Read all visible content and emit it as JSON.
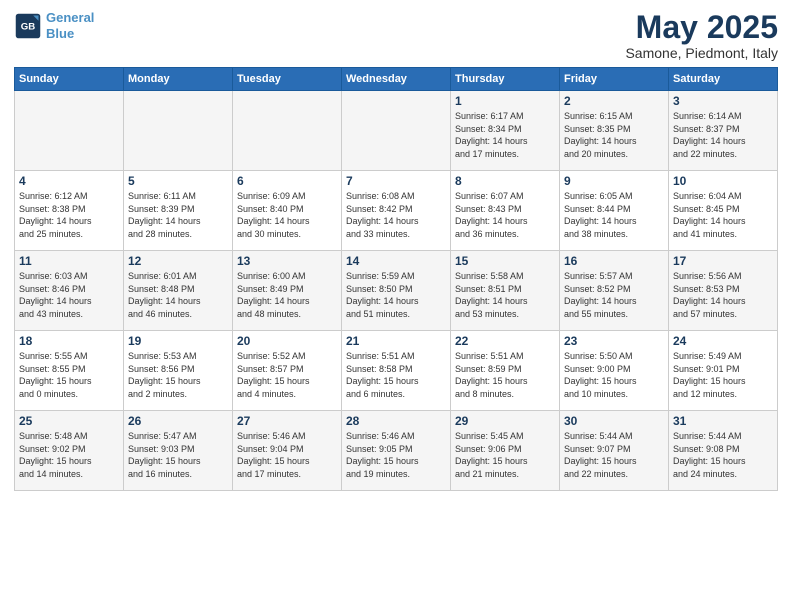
{
  "logo": {
    "line1": "General",
    "line2": "Blue"
  },
  "title": "May 2025",
  "subtitle": "Samone, Piedmont, Italy",
  "days_header": [
    "Sunday",
    "Monday",
    "Tuesday",
    "Wednesday",
    "Thursday",
    "Friday",
    "Saturday"
  ],
  "weeks": [
    [
      {
        "num": "",
        "info": ""
      },
      {
        "num": "",
        "info": ""
      },
      {
        "num": "",
        "info": ""
      },
      {
        "num": "",
        "info": ""
      },
      {
        "num": "1",
        "info": "Sunrise: 6:17 AM\nSunset: 8:34 PM\nDaylight: 14 hours\nand 17 minutes."
      },
      {
        "num": "2",
        "info": "Sunrise: 6:15 AM\nSunset: 8:35 PM\nDaylight: 14 hours\nand 20 minutes."
      },
      {
        "num": "3",
        "info": "Sunrise: 6:14 AM\nSunset: 8:37 PM\nDaylight: 14 hours\nand 22 minutes."
      }
    ],
    [
      {
        "num": "4",
        "info": "Sunrise: 6:12 AM\nSunset: 8:38 PM\nDaylight: 14 hours\nand 25 minutes."
      },
      {
        "num": "5",
        "info": "Sunrise: 6:11 AM\nSunset: 8:39 PM\nDaylight: 14 hours\nand 28 minutes."
      },
      {
        "num": "6",
        "info": "Sunrise: 6:09 AM\nSunset: 8:40 PM\nDaylight: 14 hours\nand 30 minutes."
      },
      {
        "num": "7",
        "info": "Sunrise: 6:08 AM\nSunset: 8:42 PM\nDaylight: 14 hours\nand 33 minutes."
      },
      {
        "num": "8",
        "info": "Sunrise: 6:07 AM\nSunset: 8:43 PM\nDaylight: 14 hours\nand 36 minutes."
      },
      {
        "num": "9",
        "info": "Sunrise: 6:05 AM\nSunset: 8:44 PM\nDaylight: 14 hours\nand 38 minutes."
      },
      {
        "num": "10",
        "info": "Sunrise: 6:04 AM\nSunset: 8:45 PM\nDaylight: 14 hours\nand 41 minutes."
      }
    ],
    [
      {
        "num": "11",
        "info": "Sunrise: 6:03 AM\nSunset: 8:46 PM\nDaylight: 14 hours\nand 43 minutes."
      },
      {
        "num": "12",
        "info": "Sunrise: 6:01 AM\nSunset: 8:48 PM\nDaylight: 14 hours\nand 46 minutes."
      },
      {
        "num": "13",
        "info": "Sunrise: 6:00 AM\nSunset: 8:49 PM\nDaylight: 14 hours\nand 48 minutes."
      },
      {
        "num": "14",
        "info": "Sunrise: 5:59 AM\nSunset: 8:50 PM\nDaylight: 14 hours\nand 51 minutes."
      },
      {
        "num": "15",
        "info": "Sunrise: 5:58 AM\nSunset: 8:51 PM\nDaylight: 14 hours\nand 53 minutes."
      },
      {
        "num": "16",
        "info": "Sunrise: 5:57 AM\nSunset: 8:52 PM\nDaylight: 14 hours\nand 55 minutes."
      },
      {
        "num": "17",
        "info": "Sunrise: 5:56 AM\nSunset: 8:53 PM\nDaylight: 14 hours\nand 57 minutes."
      }
    ],
    [
      {
        "num": "18",
        "info": "Sunrise: 5:55 AM\nSunset: 8:55 PM\nDaylight: 15 hours\nand 0 minutes."
      },
      {
        "num": "19",
        "info": "Sunrise: 5:53 AM\nSunset: 8:56 PM\nDaylight: 15 hours\nand 2 minutes."
      },
      {
        "num": "20",
        "info": "Sunrise: 5:52 AM\nSunset: 8:57 PM\nDaylight: 15 hours\nand 4 minutes."
      },
      {
        "num": "21",
        "info": "Sunrise: 5:51 AM\nSunset: 8:58 PM\nDaylight: 15 hours\nand 6 minutes."
      },
      {
        "num": "22",
        "info": "Sunrise: 5:51 AM\nSunset: 8:59 PM\nDaylight: 15 hours\nand 8 minutes."
      },
      {
        "num": "23",
        "info": "Sunrise: 5:50 AM\nSunset: 9:00 PM\nDaylight: 15 hours\nand 10 minutes."
      },
      {
        "num": "24",
        "info": "Sunrise: 5:49 AM\nSunset: 9:01 PM\nDaylight: 15 hours\nand 12 minutes."
      }
    ],
    [
      {
        "num": "25",
        "info": "Sunrise: 5:48 AM\nSunset: 9:02 PM\nDaylight: 15 hours\nand 14 minutes."
      },
      {
        "num": "26",
        "info": "Sunrise: 5:47 AM\nSunset: 9:03 PM\nDaylight: 15 hours\nand 16 minutes."
      },
      {
        "num": "27",
        "info": "Sunrise: 5:46 AM\nSunset: 9:04 PM\nDaylight: 15 hours\nand 17 minutes."
      },
      {
        "num": "28",
        "info": "Sunrise: 5:46 AM\nSunset: 9:05 PM\nDaylight: 15 hours\nand 19 minutes."
      },
      {
        "num": "29",
        "info": "Sunrise: 5:45 AM\nSunset: 9:06 PM\nDaylight: 15 hours\nand 21 minutes."
      },
      {
        "num": "30",
        "info": "Sunrise: 5:44 AM\nSunset: 9:07 PM\nDaylight: 15 hours\nand 22 minutes."
      },
      {
        "num": "31",
        "info": "Sunrise: 5:44 AM\nSunset: 9:08 PM\nDaylight: 15 hours\nand 24 minutes."
      }
    ]
  ]
}
